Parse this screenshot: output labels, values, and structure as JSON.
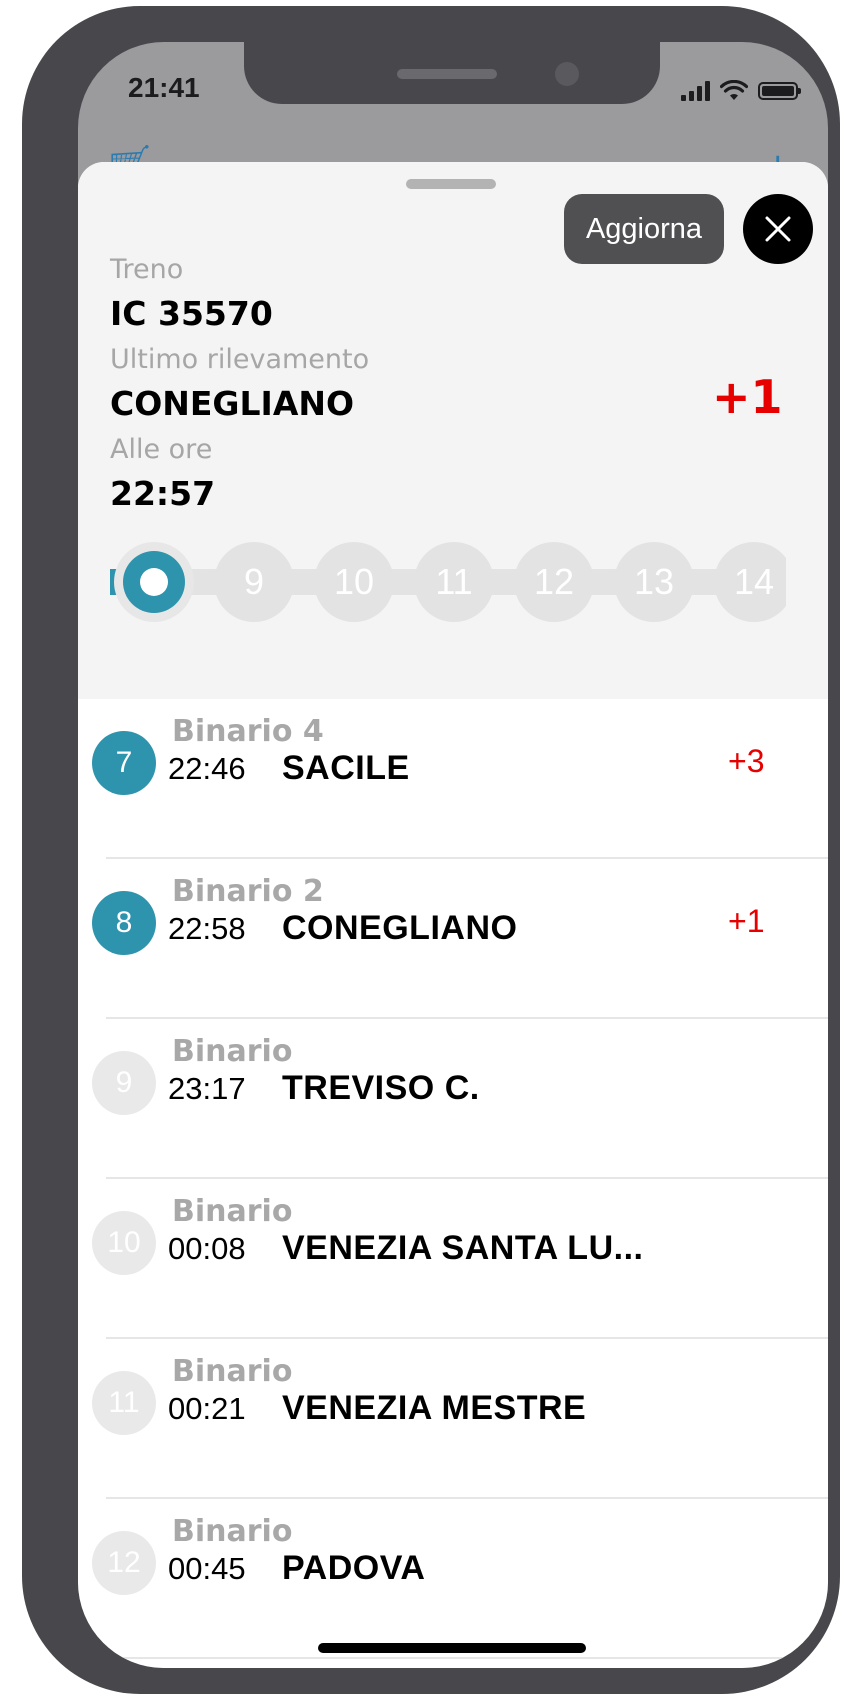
{
  "status_bar": {
    "time": "21:41"
  },
  "toolbar": {
    "refresh_label": "Aggiorna"
  },
  "train": {
    "train_label": "Treno",
    "train_number": "IC 35570",
    "last_detection_label": "Ultimo rilevamento",
    "last_detection_station": "CONEGLIANO",
    "time_label": "Alle ore",
    "time_value": "22:57",
    "delay": "+1"
  },
  "progress": {
    "upcoming_steps": [
      "9",
      "10",
      "11",
      "12",
      "13",
      "14"
    ]
  },
  "stops": [
    {
      "number": "7",
      "platform": "Binario 4",
      "time": "22:46",
      "station": "SACILE",
      "delay": "+3",
      "state": "passed"
    },
    {
      "number": "8",
      "platform": "Binario 2",
      "time": "22:58",
      "station": "CONEGLIANO",
      "delay": "+1",
      "state": "passed"
    },
    {
      "number": "9",
      "platform": "Binario",
      "time": "23:17",
      "station": "TREVISO C.",
      "delay": "",
      "state": "upcoming"
    },
    {
      "number": "10",
      "platform": "Binario",
      "time": "00:08",
      "station": "VENEZIA SANTA LU...",
      "delay": "",
      "state": "upcoming"
    },
    {
      "number": "11",
      "platform": "Binario",
      "time": "00:21",
      "station": "VENEZIA MESTRE",
      "delay": "",
      "state": "upcoming"
    },
    {
      "number": "12",
      "platform": "Binario",
      "time": "00:45",
      "station": "PADOVA",
      "delay": "",
      "state": "upcoming"
    }
  ],
  "colors": {
    "accent": "#2e93ad",
    "delay": "#e60000",
    "muted": "#a6a6a6",
    "frame": "#48474c"
  },
  "icons": [
    "close-icon",
    "signal-icon",
    "wifi-icon",
    "battery-icon"
  ]
}
